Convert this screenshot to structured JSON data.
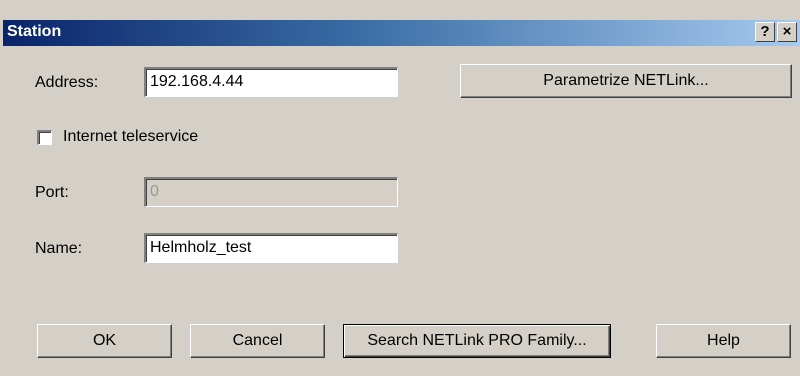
{
  "window": {
    "title": "Station",
    "help_button": "?",
    "close_button": "×"
  },
  "form": {
    "address_label": "Address:",
    "address_value": "192.168.4.44",
    "internet_teleservice_label": "Internet teleservice",
    "internet_teleservice_checked": false,
    "port_label": "Port:",
    "port_value": "0",
    "name_label": "Name:",
    "name_value": "Helmholz_test"
  },
  "buttons": {
    "parametrize": "Parametrize NETLink...",
    "ok": "OK",
    "cancel": "Cancel",
    "search": "Search NETLink PRO Family...",
    "help": "Help"
  }
}
